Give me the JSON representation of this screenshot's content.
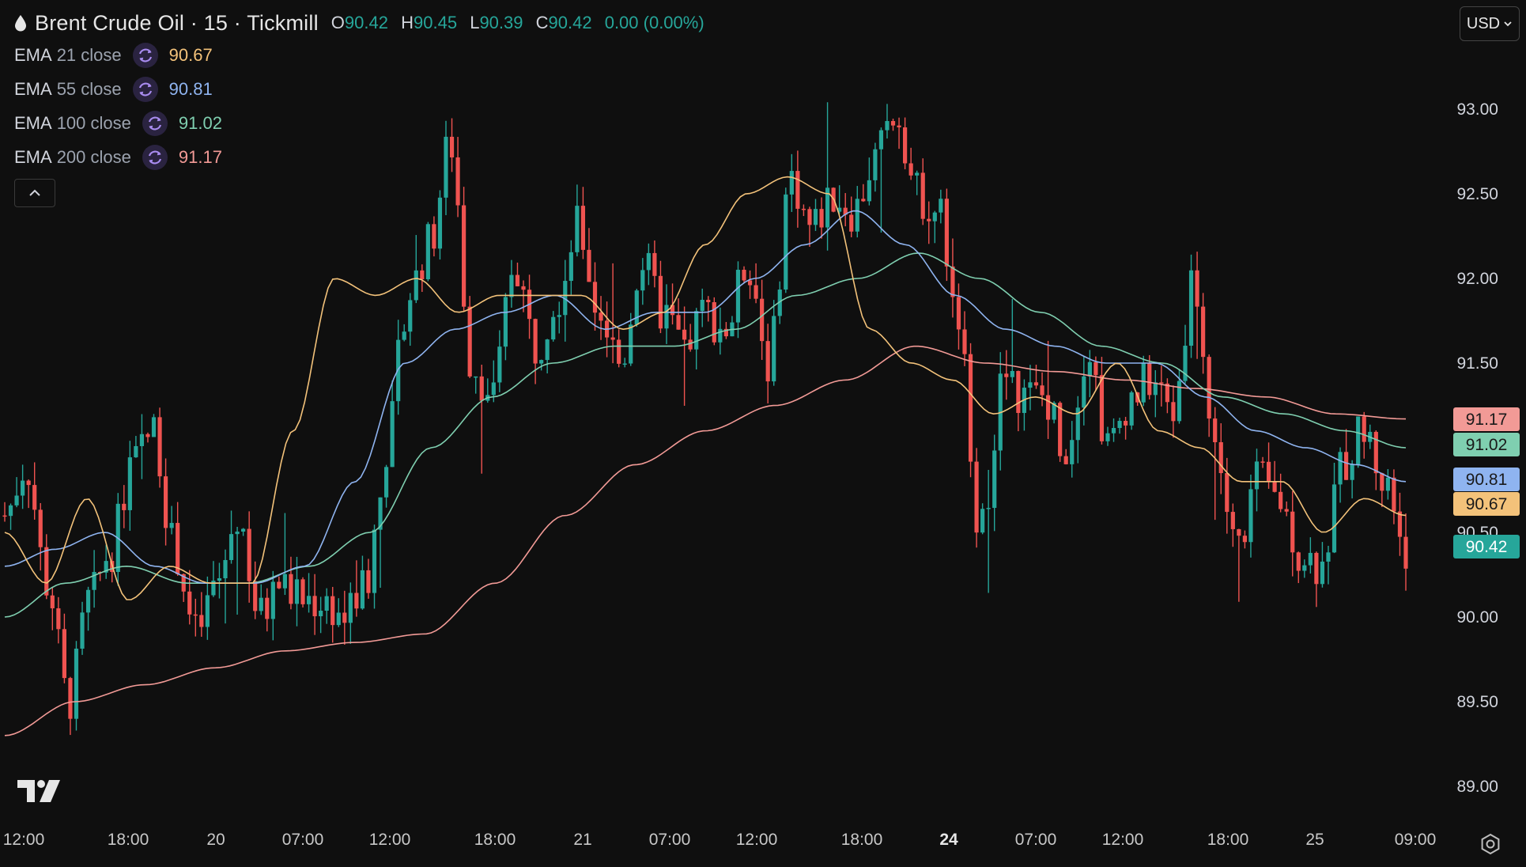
{
  "header": {
    "symbol": "Brent Crude Oil · 15 · Tickmill",
    "ohlc": {
      "o_label": "O",
      "o": "90.42",
      "h_label": "H",
      "h": "90.45",
      "l_label": "L",
      "l": "90.39",
      "c_label": "C",
      "c": "90.42",
      "change": "0.00 (0.00%)"
    },
    "currency": "USD"
  },
  "indicators": [
    {
      "name": "EMA",
      "params": "21 close",
      "value": "90.67",
      "color": "#f3c27a"
    },
    {
      "name": "EMA",
      "params": "55 close",
      "value": "90.81",
      "color": "#8fb4f0"
    },
    {
      "name": "EMA",
      "params": "100 close",
      "value": "91.02",
      "color": "#7fcfb0"
    },
    {
      "name": "EMA",
      "params": "200 close",
      "value": "91.17",
      "color": "#f29a96"
    }
  ],
  "icons": [
    "droplet-icon",
    "refresh-icon",
    "chevron-up-icon",
    "chevron-down-icon",
    "tradingview-logo",
    "settings-icon"
  ],
  "chart_data": {
    "type": "candlestick",
    "ylim": [
      88.9,
      93.4
    ],
    "price_ticks": [
      "93.00",
      "92.50",
      "92.00",
      "91.50",
      "90.50",
      "90.00",
      "89.50",
      "89.00"
    ],
    "time_ticks": [
      "12:00",
      "18:00",
      "20",
      "07:00",
      "12:00",
      "18:00",
      "21",
      "07:00",
      "12:00",
      "18:00",
      "24",
      "07:00",
      "12:00",
      "18:00",
      "25",
      "09:00"
    ],
    "bold_time_tick": "24",
    "colors": {
      "up": "#26a69a",
      "down": "#ef5350",
      "grid": "none"
    },
    "price_labels": [
      {
        "text": "91.17",
        "value": 91.17,
        "bg": "#f29a96",
        "fg": "#1a1a1a"
      },
      {
        "text": "91.02",
        "value": 91.02,
        "bg": "#7fcfb0",
        "fg": "#1a1a1a"
      },
      {
        "text": "90.81",
        "value": 90.81,
        "bg": "#8fb4f0",
        "fg": "#1a1a1a"
      },
      {
        "text": "90.67",
        "value": 90.67,
        "bg": "#f3c27a",
        "fg": "#1a1a1a"
      },
      {
        "text": "90.42",
        "value": 90.42,
        "bg": "#26a69a",
        "fg": "#ffffff"
      }
    ],
    "price_path_knots": [
      90.6,
      90.9,
      90.2,
      89.5,
      90.1,
      90.4,
      90.9,
      91.1,
      90.4,
      89.9,
      90.2,
      90.6,
      90.0,
      90.2,
      90.1,
      90.1,
      90.0,
      90.2,
      91.0,
      91.9,
      92.2,
      92.8,
      91.5,
      91.3,
      92.1,
      91.6,
      91.9,
      92.3,
      91.8,
      91.5,
      92.1,
      91.8,
      91.6,
      91.8,
      91.7,
      92.1,
      91.5,
      92.6,
      92.3,
      92.5,
      92.4,
      92.7,
      93.0,
      92.5,
      92.4,
      91.6,
      90.5,
      91.4,
      91.3,
      91.3,
      91.0,
      91.6,
      91.0,
      91.3,
      91.4,
      91.2,
      92.0,
      91.0,
      90.4,
      90.8,
      90.7,
      90.4,
      90.3,
      90.9,
      91.1,
      90.8,
      90.42
    ],
    "ema_21_knots": [
      90.5,
      90.2,
      90.7,
      90.1,
      90.3,
      90.2,
      90.2,
      91.1,
      92.0,
      91.9,
      92.0,
      91.8,
      91.9,
      91.9,
      91.9,
      91.7,
      91.8,
      92.2,
      92.5,
      92.6,
      92.5,
      91.7,
      91.5,
      91.4,
      91.2,
      91.3,
      91.2,
      91.5,
      91.1,
      91.0,
      90.8,
      90.8,
      90.5,
      90.7,
      90.6
    ],
    "ema_55_knots": [
      90.3,
      90.4,
      90.5,
      90.3,
      90.2,
      90.2,
      90.3,
      90.8,
      91.5,
      91.7,
      91.8,
      91.9,
      91.7,
      91.8,
      91.8,
      92.0,
      92.2,
      92.4,
      92.2,
      91.9,
      91.7,
      91.6,
      91.5,
      91.5,
      91.3,
      91.1,
      91.0,
      90.9,
      90.8
    ],
    "ema_100_knots": [
      90.0,
      90.2,
      90.3,
      90.2,
      90.2,
      90.3,
      90.5,
      91.0,
      91.3,
      91.5,
      91.6,
      91.6,
      91.7,
      91.9,
      92.0,
      92.15,
      92.0,
      91.8,
      91.6,
      91.5,
      91.3,
      91.2,
      91.1,
      91.0
    ],
    "ema_200_knots": [
      89.3,
      89.5,
      89.6,
      89.7,
      89.8,
      89.85,
      89.9,
      90.2,
      90.6,
      90.9,
      91.1,
      91.25,
      91.4,
      91.6,
      91.5,
      91.45,
      91.4,
      91.35,
      91.3,
      91.2,
      91.17
    ]
  }
}
